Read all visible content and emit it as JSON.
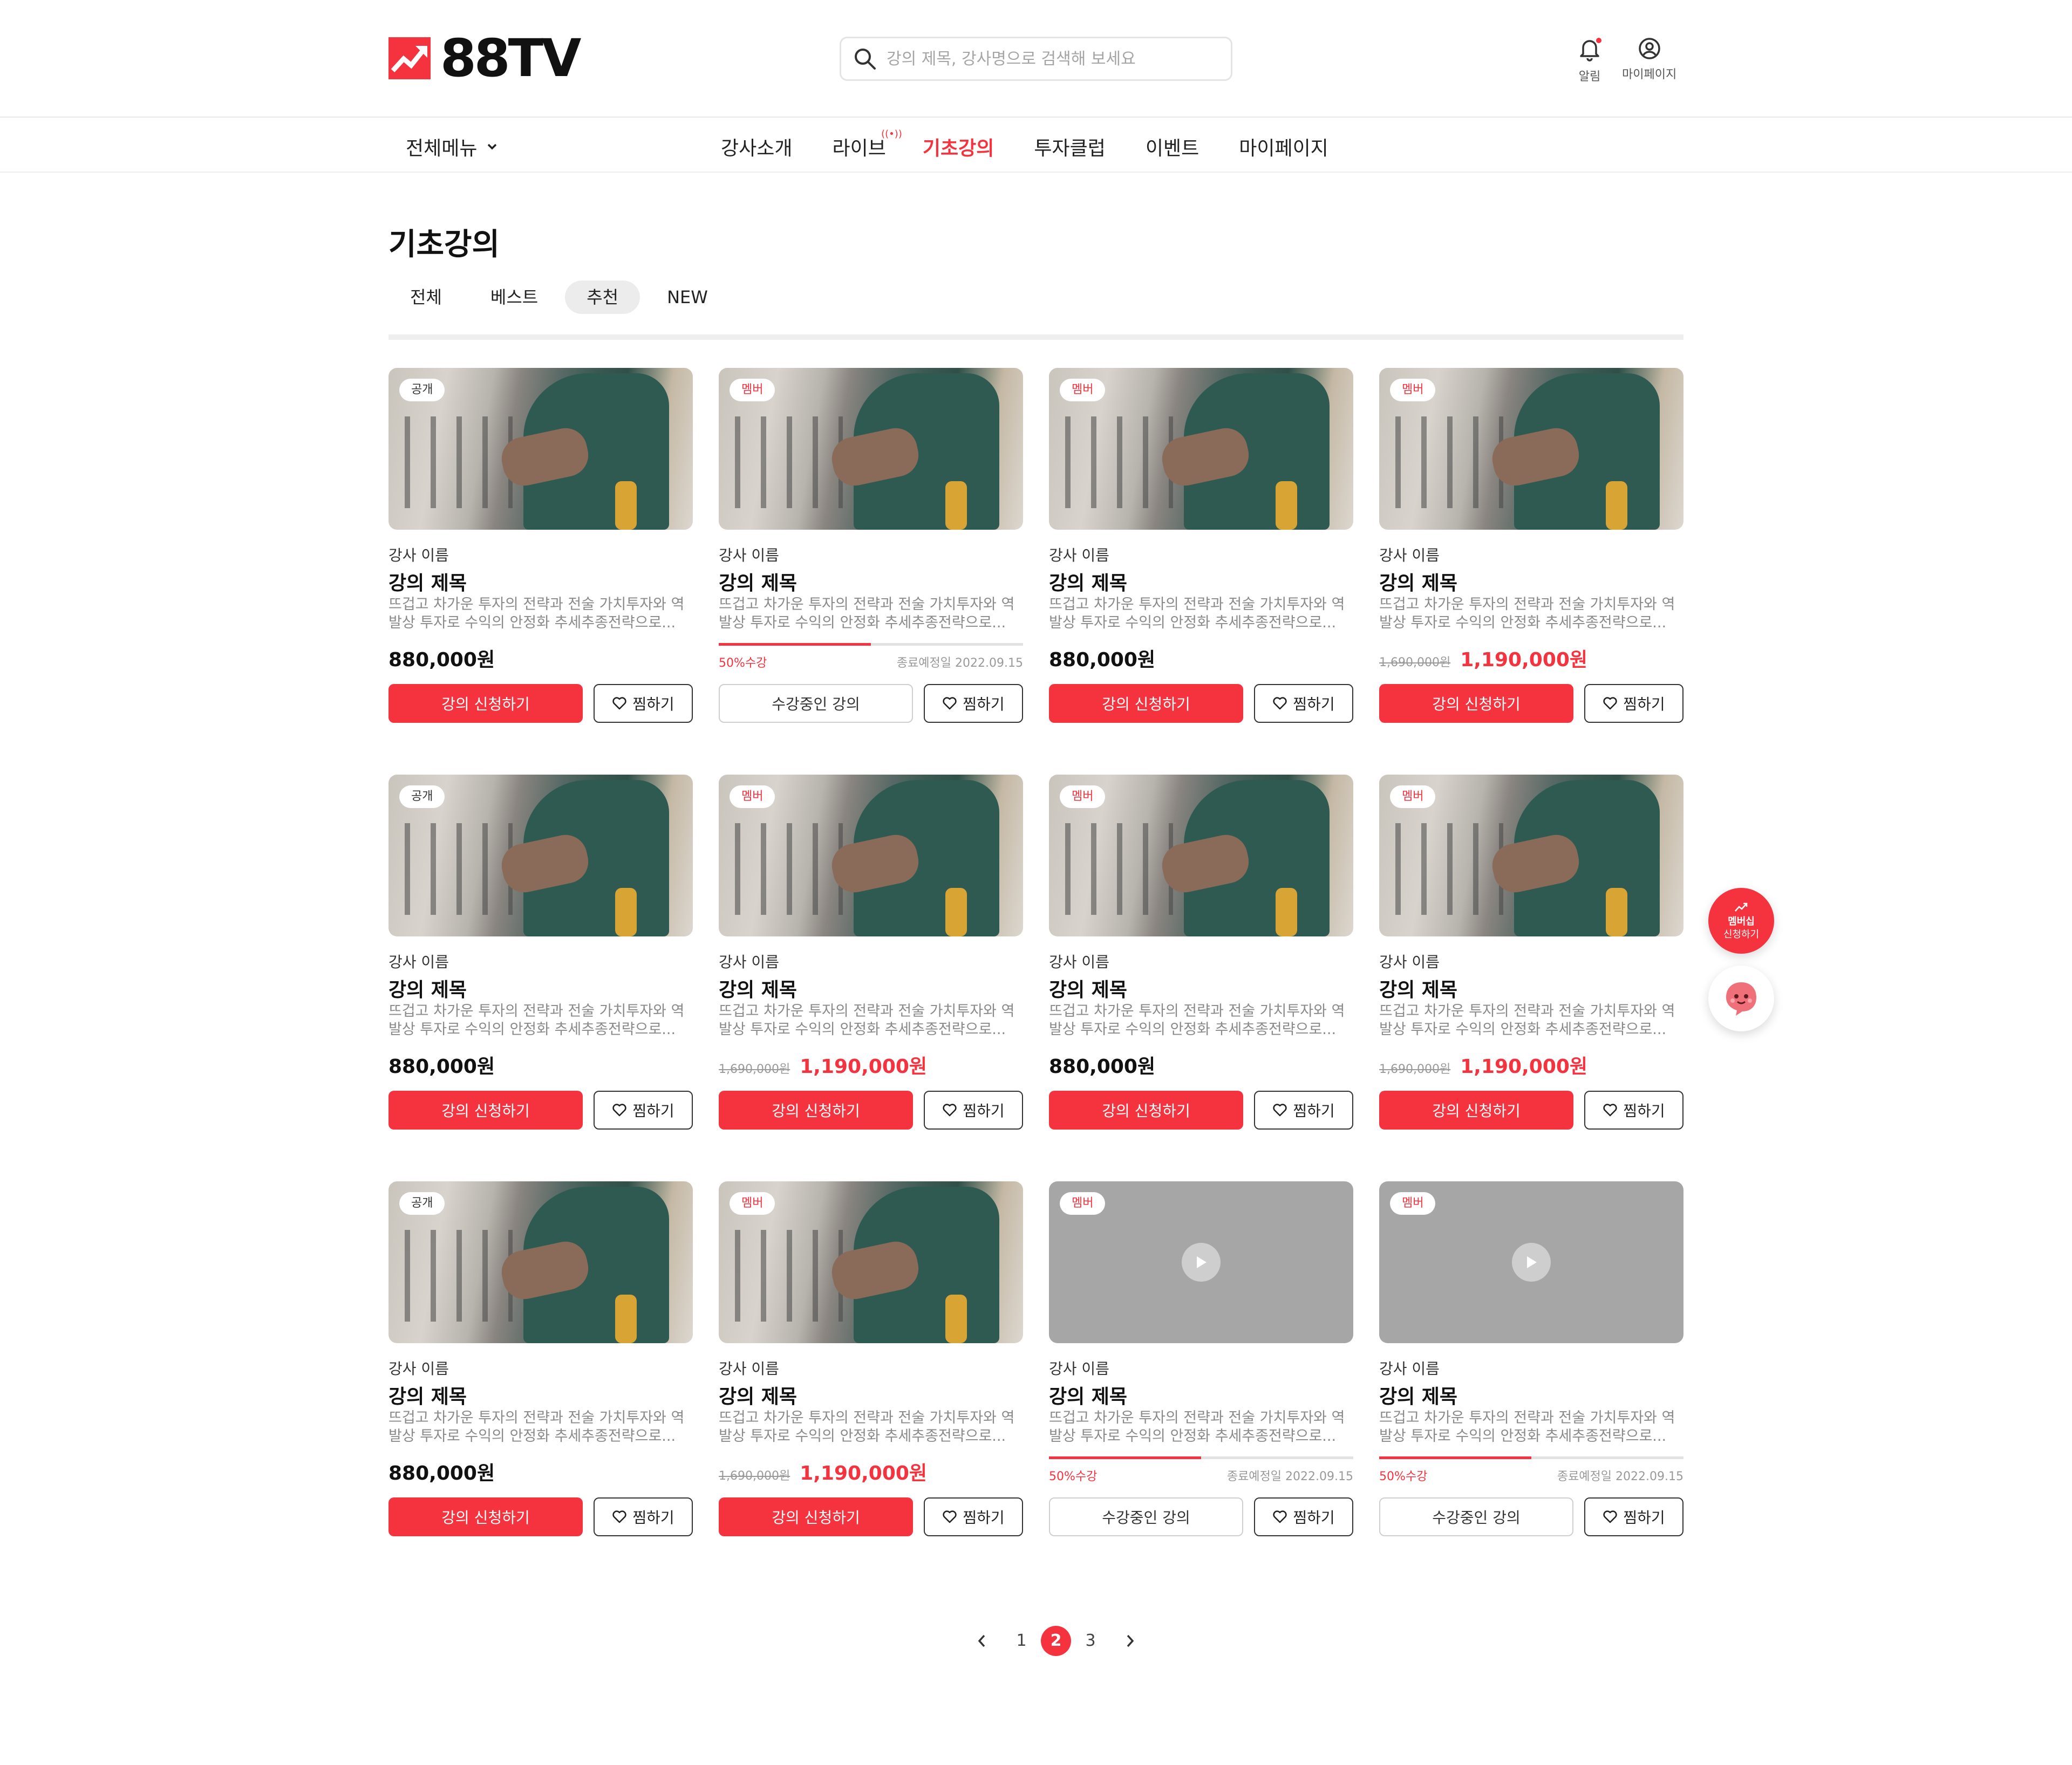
{
  "brand": {
    "name": "88TV",
    "accent": "#f5333f"
  },
  "search": {
    "placeholder": "강의 제목, 강사명으로 검색해 보세요"
  },
  "header": {
    "notifications_label": "알림",
    "mypage_label": "마이페이지"
  },
  "nav": {
    "all_menu": "전체메뉴",
    "items": [
      "강사소개",
      "라이브",
      "기초강의",
      "투자클럽",
      "이벤트",
      "마이페이지"
    ],
    "active": "기초강의"
  },
  "page": {
    "title": "기초강의",
    "tabs": [
      "전체",
      "베스트",
      "추천",
      "NEW"
    ],
    "active_tab": "추천"
  },
  "card_common": {
    "instructor": "강사 이름",
    "title": "강의 제목",
    "description": "뜨겁고 차가운 투자의 전략과 전술 가치투자와 역발상 투자로 수익의 안정화 추세추종전략으로...",
    "apply_label": "강의 신청하기",
    "enrolled_label": "수강중인 강의",
    "wish_label": "찜하기"
  },
  "cards": [
    {
      "badge": "공개",
      "type": "price",
      "price": "880,000원"
    },
    {
      "badge": "멤버",
      "type": "progress",
      "progress": 0.5,
      "progress_label": "50%수강",
      "end_date": "종료예정일 2022.09.15"
    },
    {
      "badge": "멤버",
      "type": "price",
      "price": "880,000원"
    },
    {
      "badge": "멤버",
      "type": "sale",
      "orig_price": "1,690,000원",
      "price": "1,190,000원"
    },
    {
      "badge": "공개",
      "type": "price",
      "price": "880,000원"
    },
    {
      "badge": "멤버",
      "type": "sale",
      "orig_price": "1,690,000원",
      "price": "1,190,000원"
    },
    {
      "badge": "멤버",
      "type": "price",
      "price": "880,000원"
    },
    {
      "badge": "멤버",
      "type": "sale",
      "orig_price": "1,690,000원",
      "price": "1,190,000원"
    },
    {
      "badge": "공개",
      "type": "price",
      "price": "880,000원"
    },
    {
      "badge": "멤버",
      "type": "sale",
      "orig_price": "1,690,000원",
      "price": "1,190,000원"
    },
    {
      "badge": "멤버",
      "type": "progress",
      "thumb": "placeholder",
      "progress": 0.5,
      "progress_label": "50%수강",
      "end_date": "종료예정일 2022.09.15"
    },
    {
      "badge": "멤버",
      "type": "progress",
      "thumb": "placeholder",
      "progress": 0.5,
      "progress_label": "50%수강",
      "end_date": "종료예정일 2022.09.15"
    }
  ],
  "floating": {
    "member_line1": "멤버십",
    "member_line2": "신청하기"
  },
  "pagination": {
    "pages": [
      "1",
      "2",
      "3"
    ],
    "current": "2"
  }
}
